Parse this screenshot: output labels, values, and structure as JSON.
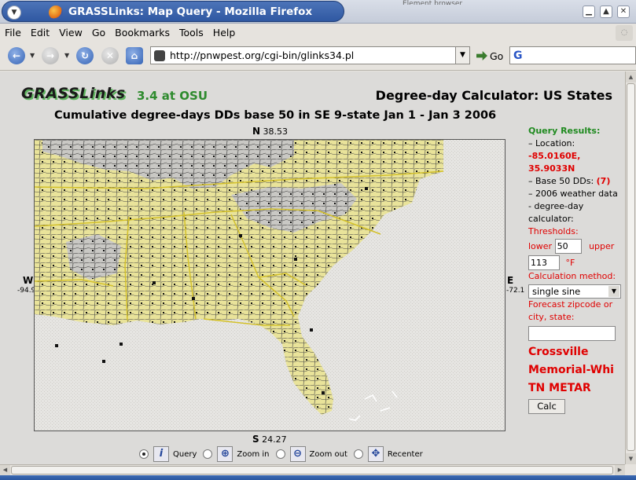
{
  "window": {
    "title": "GRASSLinks: Map Query - Mozilla Firefox",
    "background_tab": "Element browser"
  },
  "menu": [
    "File",
    "Edit",
    "View",
    "Go",
    "Bookmarks",
    "Tools",
    "Help"
  ],
  "nav": {
    "url": "http://pnwpest.org/cgi-bin/glinks34.pl",
    "go_label": "Go",
    "search_value": ""
  },
  "page": {
    "logo": "GRASSLinks",
    "version": "3.4 at OSU",
    "calculator_title": "Degree-day Calculator: US States",
    "map_title": "Cumulative degree-days DDs base 50 in SE 9-state Jan 1 - Jan 3 2006",
    "north": {
      "letter": "N",
      "value": "38.53"
    },
    "south": {
      "letter": "S",
      "value": "24.27"
    },
    "west": {
      "letter": "W",
      "value": "-94.9"
    },
    "east": {
      "letter": "E",
      "value": "-72.1"
    }
  },
  "tools": {
    "selected": "Query",
    "items": [
      {
        "label": "Query",
        "icon": "info-icon"
      },
      {
        "label": "Zoom in",
        "icon": "zoom-in-icon"
      },
      {
        "label": "Zoom out",
        "icon": "zoom-out-icon"
      },
      {
        "label": "Recenter",
        "icon": "recenter-icon"
      }
    ]
  },
  "results": {
    "heading": "Query Results:",
    "location_label": "– Location:",
    "location_value": "-85.0160E, 35.9033N",
    "base_label": "– Base 50 DDs:",
    "base_value": "(7)",
    "weather_text": "– 2006 weather data - degree-day calculator:",
    "thresholds_label": "Thresholds:",
    "lower_label": "lower",
    "lower_value": "50",
    "upper_label": "upper",
    "upper_value": "113",
    "unit": "°F",
    "method_label": "Calculation method:",
    "method_value": "single sine",
    "forecast_label": "Forecast zipcode or city, state:",
    "forecast_value": "",
    "station_line1": "Crossville",
    "station_line2": "Memorial-Whi",
    "station_line3": "TN METAR",
    "calc_button": "Calc"
  },
  "colors": {
    "land": "#e9e39a",
    "county_line": "#444444",
    "state_line": "#d4c12a",
    "result_green": "#1f8a1f",
    "result_red": "#e00000"
  }
}
